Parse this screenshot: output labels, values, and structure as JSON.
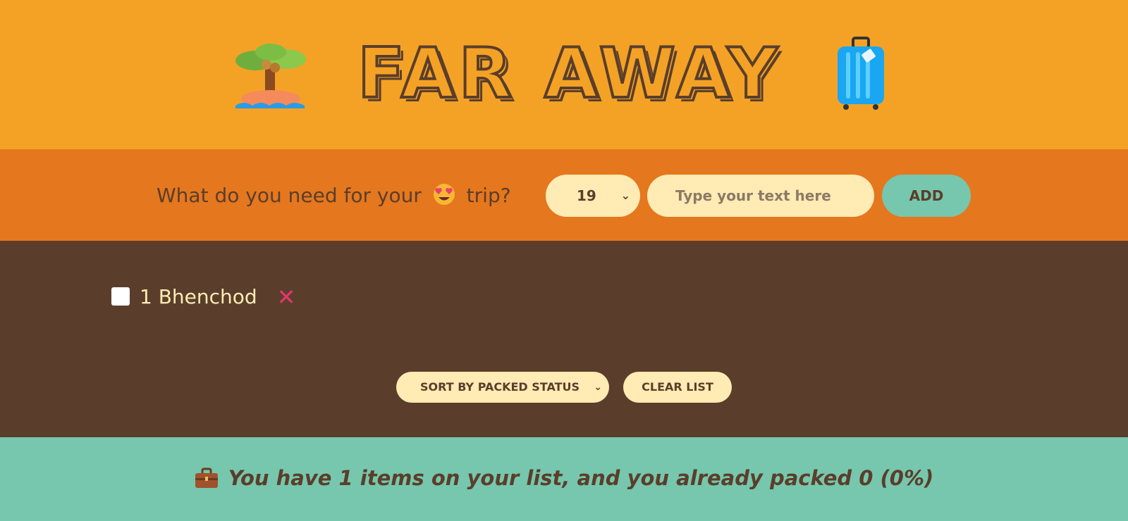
{
  "header": {
    "title": "FAR AWAY",
    "left_icon": "palm-island-icon",
    "right_icon": "suitcase-icon"
  },
  "form": {
    "question_prefix": "What do you need for your",
    "question_emoji": "heart-eyes-emoji",
    "question_suffix": "trip?",
    "quantity_value": "19",
    "text_placeholder": "Type your text here",
    "text_value": "",
    "add_label": "ADD"
  },
  "list": {
    "items": [
      {
        "label": "1 Bhenchod",
        "packed": false
      }
    ],
    "sort_value": "SORT BY PACKED STATUS",
    "clear_label": "CLEAR LIST"
  },
  "stats": {
    "icon": "briefcase-icon",
    "text": "You have 1 items on your list, and you already packed 0 (0%)"
  },
  "colors": {
    "header_bg": "#f4a226",
    "form_bg": "#e5771e",
    "list_bg": "#5a3e2b",
    "stats_bg": "#76c7ad",
    "cream": "#ffebb3",
    "delete": "#e5366a"
  }
}
